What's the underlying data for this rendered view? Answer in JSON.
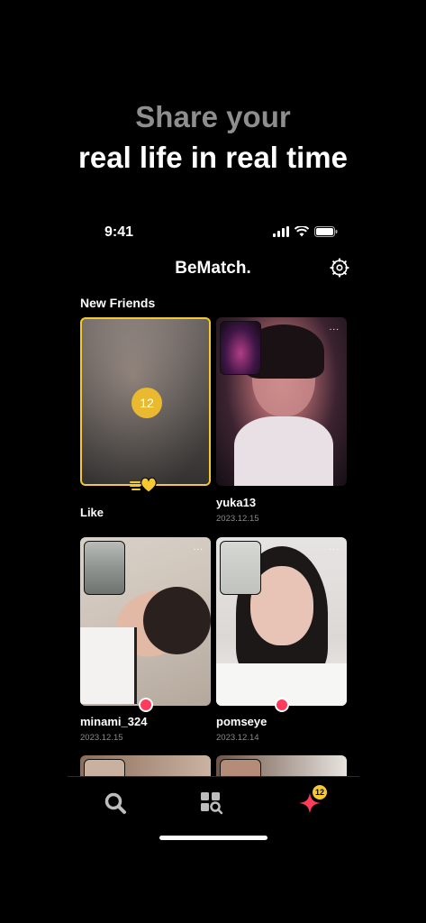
{
  "headline": {
    "line1": "Share your",
    "line2": "real life in real time"
  },
  "status_bar": {
    "time": "9:41"
  },
  "app": {
    "title": "BeMatch."
  },
  "section": {
    "new_friends": "New Friends"
  },
  "featured": {
    "count": "12",
    "like_label": "Like"
  },
  "cards": [
    {
      "name": "yuka13",
      "date": "2023.12.15",
      "more": "..."
    },
    {
      "name": "minami_324",
      "date": "2023.12.15",
      "more": "..."
    },
    {
      "name": "pomseye",
      "date": "2023.12.14",
      "more": "..."
    }
  ],
  "tabbar": {
    "badge_count": "12"
  },
  "colors": {
    "accent_yellow": "#f6c933",
    "accent_pink": "#ff3b5c"
  },
  "icons": [
    "wifi-icon",
    "signal-icon",
    "battery-icon",
    "gear-icon",
    "search-icon",
    "discover-icon",
    "sparkle-icon",
    "hand-heart-icon"
  ]
}
